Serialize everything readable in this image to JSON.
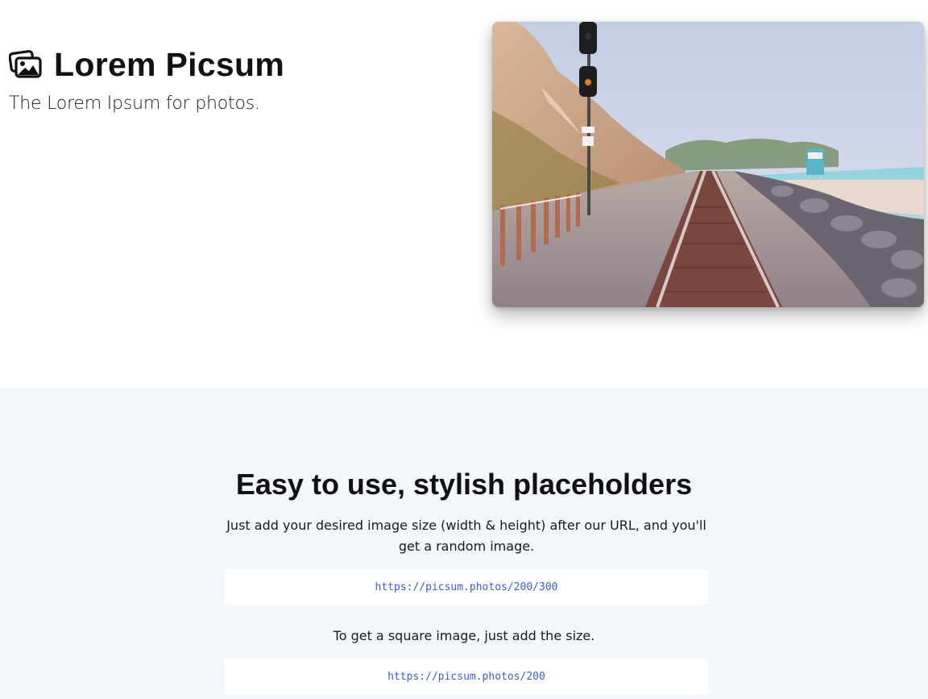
{
  "hero": {
    "brand_icon": "images-icon",
    "title": "Lorem Picsum",
    "tagline": "The Lorem Ipsum for photos.",
    "photo": "railway-tracks-by-the-sea-photo"
  },
  "features": {
    "heading": "Easy to use, stylish placeholders",
    "description": "Just add your desired image size (width & height) after our URL, and you'll get a random image.",
    "example_url_1": "https://picsum.photos/200/300",
    "square_text": "To get a square image, just add the size.",
    "example_url_2": "https://picsum.photos/200"
  },
  "colors": {
    "section_background": "#f3f6fa",
    "code_text": "#3b5bdb"
  }
}
